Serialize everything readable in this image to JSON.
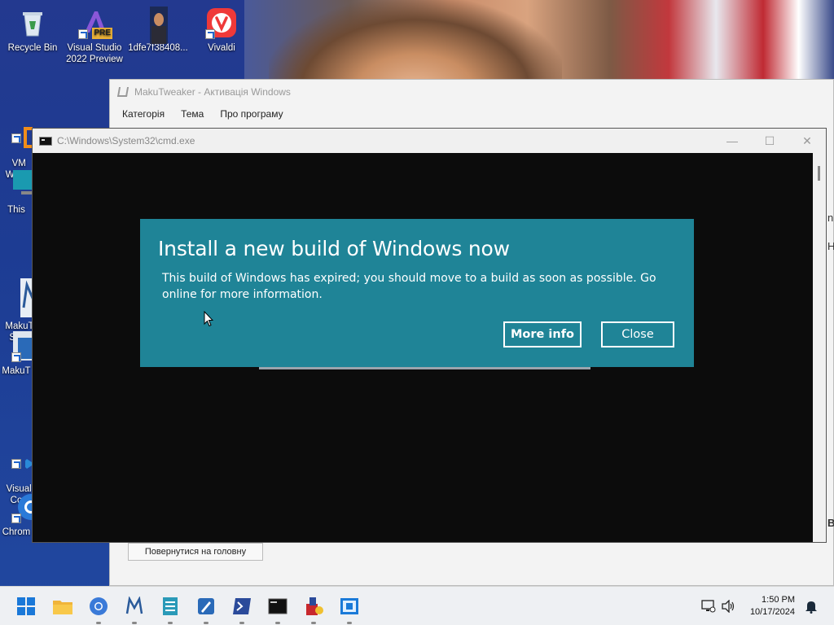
{
  "desktop": {
    "icons": [
      {
        "label": "Recycle Bin",
        "icon": "recycle-bin-icon"
      },
      {
        "label": "Visual Studio 2022 Preview",
        "icon": "visual-studio-icon",
        "badge": "PRE"
      },
      {
        "label": "1dfe7f38408...",
        "icon": "image-file-icon"
      },
      {
        "label": "Vivaldi",
        "icon": "vivaldi-icon"
      },
      {
        "label": "VM\nWork",
        "icon": "vmware-icon"
      },
      {
        "label": "This",
        "icon": "this-pc-icon"
      },
      {
        "label": "MakuT\nSet",
        "icon": "makutweaker-setup-icon"
      },
      {
        "label": "MakuT",
        "icon": "makutweaker-icon"
      },
      {
        "label": "Visual\nCo",
        "icon": "vscode-icon"
      },
      {
        "label": "Chrom",
        "icon": "chrome-icon"
      }
    ]
  },
  "maku": {
    "title": "MakuTweaker - Активація Windows",
    "menu": [
      "Категорія",
      "Тема",
      "Про програму"
    ],
    "back_button": "Повернутися на головну",
    "edge_chars": [
      "n",
      "H",
      "B"
    ]
  },
  "cmd": {
    "title": "C:\\Windows\\System32\\cmd.exe",
    "controls": {
      "minimize": "—",
      "maximize": "☐",
      "close": "✕"
    }
  },
  "dialog": {
    "title": "Install a new build of Windows now",
    "body": "This build of Windows has expired; you should move to a build as soon as possible. Go online for more information.",
    "more_info": "More info",
    "close": "Close",
    "background_color": "#1f8497"
  },
  "taskbar": {
    "items": [
      "start-icon",
      "file-explorer-icon",
      "chromium-icon",
      "makutweaker-icon",
      "notepad-icon",
      "paint-icon",
      "powershell-icon",
      "terminal-icon",
      "installer-icon",
      "sandbox-icon"
    ],
    "time": "1:50 PM",
    "date": "10/17/2024"
  }
}
